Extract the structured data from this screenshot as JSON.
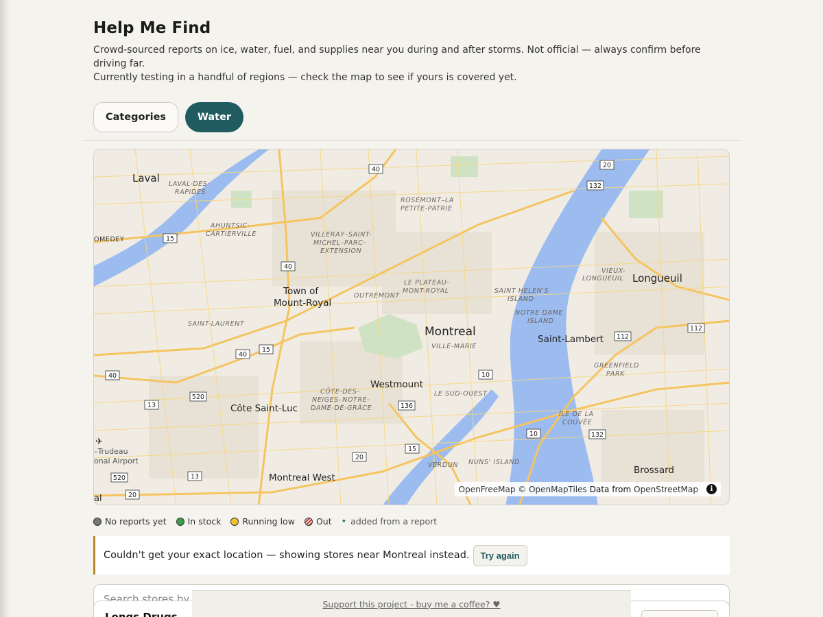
{
  "header": {
    "title": "Help Me Find",
    "intro_line1": "Crowd-sourced reports on ice, water, fuel, and supplies near you during and after storms. Not official — always confirm before driving far.",
    "intro_line2": "Currently testing in a handful of regions — check the map to see if yours is covered yet."
  },
  "chips": {
    "categories_label": "Categories",
    "water_label": "Water",
    "active": "Water",
    "active_color": "#1f5b5f"
  },
  "map": {
    "cities": [
      "Laval",
      "Longueuil",
      "Montreal",
      "Town of",
      "Mount-Royal",
      "Saint-Lambert",
      "Westmount",
      "Côte Saint-Luc",
      "Montreal West",
      "Brossard"
    ],
    "boroughs": [
      "LAVAL-DES-",
      "RAPIDES",
      "AHUNTSIC-",
      "CARTIERVILLE",
      "ROSEMONT–LA",
      "PETITE-PATRIE",
      "VILLERAY–SAINT-",
      "MICHEL–PARC-",
      "EXTENSION",
      "OUTREMONT",
      "LE PLATEAU-",
      "MONT-ROYAL",
      "SAINT HELEN'S",
      "ISLAND",
      "NOTRE DAME",
      "ISLAND",
      "VIEUX-",
      "LONGUEUIL",
      "SAINT-LAURENT",
      "VILLE-MARIE",
      "CÔTE-DES-",
      "NEIGES–NOTRE-",
      "DAME-DE-GRÂCE",
      "LE SUD-OUEST",
      "GREENFIELD",
      "PARK",
      "ÎLE DE LA",
      "COUVÉE",
      "VERDUN",
      "NUNS' ISLAND",
      "OMEDEY"
    ],
    "shields": [
      "40",
      "20",
      "132",
      "15",
      "40",
      "112",
      "112",
      "15",
      "40",
      "40",
      "10",
      "520",
      "13",
      "136",
      "10",
      "132",
      "15",
      "20",
      "13",
      "520",
      "20"
    ],
    "airport_line1": "–Trudeau",
    "airport_line2": "onal Airport",
    "edge_label": "al",
    "attribution_part1": "OpenFreeMap © OpenMapTiles",
    "attribution_part2": "Data from",
    "attribution_part3": "OpenStreetMap",
    "info_glyph": "i",
    "water_color": "#9cbcf0",
    "road_color": "#f7d67e"
  },
  "legend": {
    "no_reports": "No reports yet",
    "in_stock": "In stock",
    "running_low": "Running low",
    "out": "Out",
    "added": "added from a report",
    "colors": {
      "none": "#777777",
      "stock": "#3aa04a",
      "low": "#f2c12e",
      "out": "#c0392b"
    }
  },
  "notice": {
    "text": "Couldn't get your exact location — showing stores near Montreal instead.",
    "button": "Try again",
    "accent": "#b8862a"
  },
  "search": {
    "placeholder": "Search stores by name..."
  },
  "store": {
    "name": "Longs Drugs"
  },
  "support": {
    "link": "Support this project - buy me a coffee? ♥"
  }
}
